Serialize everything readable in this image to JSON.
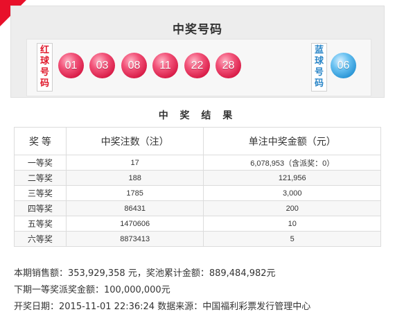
{
  "draw_panel": {
    "title": "中奖号码",
    "red_label": "红球号码",
    "blue_label": "蓝球号码",
    "red_balls": [
      "01",
      "03",
      "08",
      "11",
      "22",
      "28"
    ],
    "blue_ball": "06"
  },
  "results": {
    "title": "中 奖 结 果",
    "headers": [
      "奖  等",
      "中奖注数（注）",
      "单注中奖金额（元）"
    ],
    "rows": [
      {
        "level": "一等奖",
        "count": "17",
        "amount": "6,078,953（含派奖：0）"
      },
      {
        "level": "二等奖",
        "count": "188",
        "amount": "121,956"
      },
      {
        "level": "三等奖",
        "count": "1785",
        "amount": "3,000"
      },
      {
        "level": "四等奖",
        "count": "86431",
        "amount": "200"
      },
      {
        "level": "五等奖",
        "count": "1470606",
        "amount": "10"
      },
      {
        "level": "六等奖",
        "count": "8873413",
        "amount": "5"
      }
    ]
  },
  "info": {
    "sales": "本期销售额：353,929,358 元，奖池累计金额：889,484,982元",
    "next_prize": "下期一等奖派奖金额：100,000,000元",
    "draw_date": "开奖日期：2015-11-01 22:36:24 数据来源：中国福利彩票发行管理中心"
  },
  "colors": {
    "corner_accent": "#e8102a",
    "red_ball": "#d81c47",
    "blue_ball": "#2b96d6",
    "red_label": "#e0182b",
    "blue_label": "#2a86c8"
  }
}
